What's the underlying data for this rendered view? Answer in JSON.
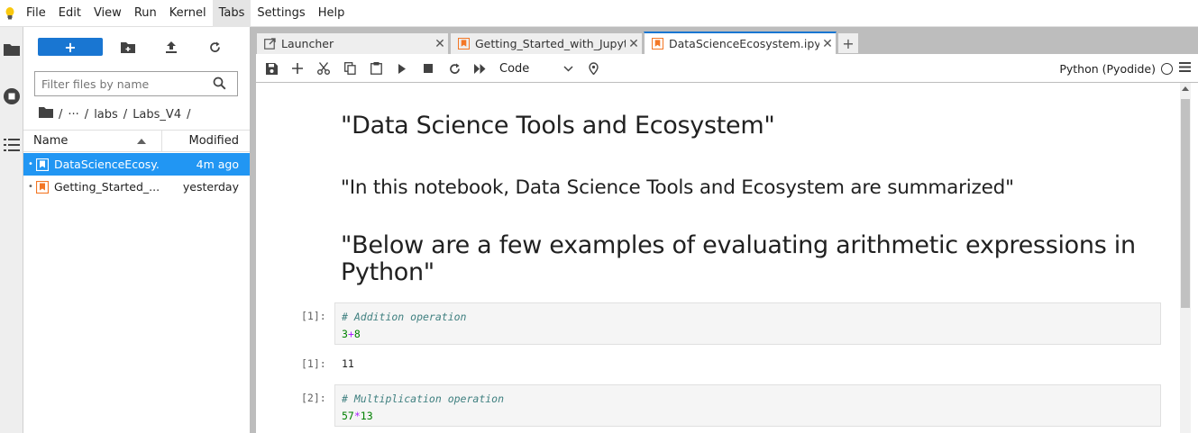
{
  "menubar": {
    "items": [
      "File",
      "Edit",
      "View",
      "Run",
      "Kernel",
      "Tabs",
      "Settings",
      "Help"
    ],
    "active": "Tabs"
  },
  "filebrowser": {
    "new_label": "+",
    "filter_placeholder": "Filter files by name",
    "breadcrumb": [
      "/",
      "···",
      "/",
      "labs",
      "/",
      "Labs_V4",
      "/"
    ],
    "columns": {
      "name": "Name",
      "modified": "Modified"
    },
    "files": [
      {
        "name": "DataScienceEcosy...",
        "modified": "4m ago",
        "selected": true
      },
      {
        "name": "Getting_Started_...",
        "modified": "yesterday",
        "selected": false
      }
    ]
  },
  "tabs": [
    {
      "label": "Launcher",
      "icon": "launcher-icon"
    },
    {
      "label": "Getting_Started_with_Jupyter",
      "icon": "notebook-icon"
    },
    {
      "label": "DataScienceEcosystem.ipynb",
      "icon": "notebook-icon",
      "active": true
    }
  ],
  "add_tab_label": "+",
  "toolbar": {
    "cell_type": "Code",
    "kernel_name": "Python (Pyodide)"
  },
  "notebook": {
    "h1": "\"Data Science Tools and Ecosystem\"",
    "h2": "\"In this notebook, Data Science Tools and Ecosystem are summarized\"",
    "h3": "\"Below are a few examples of evaluating arithmetic expressions in Python\"",
    "cells": [
      {
        "prompt": "[1]:",
        "comment": "# Addition operation",
        "a": "3",
        "op": "+",
        "b": "8",
        "out_prompt": "[1]:",
        "output": "11"
      },
      {
        "prompt": "[2]:",
        "comment": "# Multiplication operation",
        "a": "57",
        "op": "*",
        "b": "13"
      }
    ]
  },
  "colors": {
    "accent": "#1976d2",
    "selection": "#2196f3",
    "notebook_icon": "#f37726"
  }
}
